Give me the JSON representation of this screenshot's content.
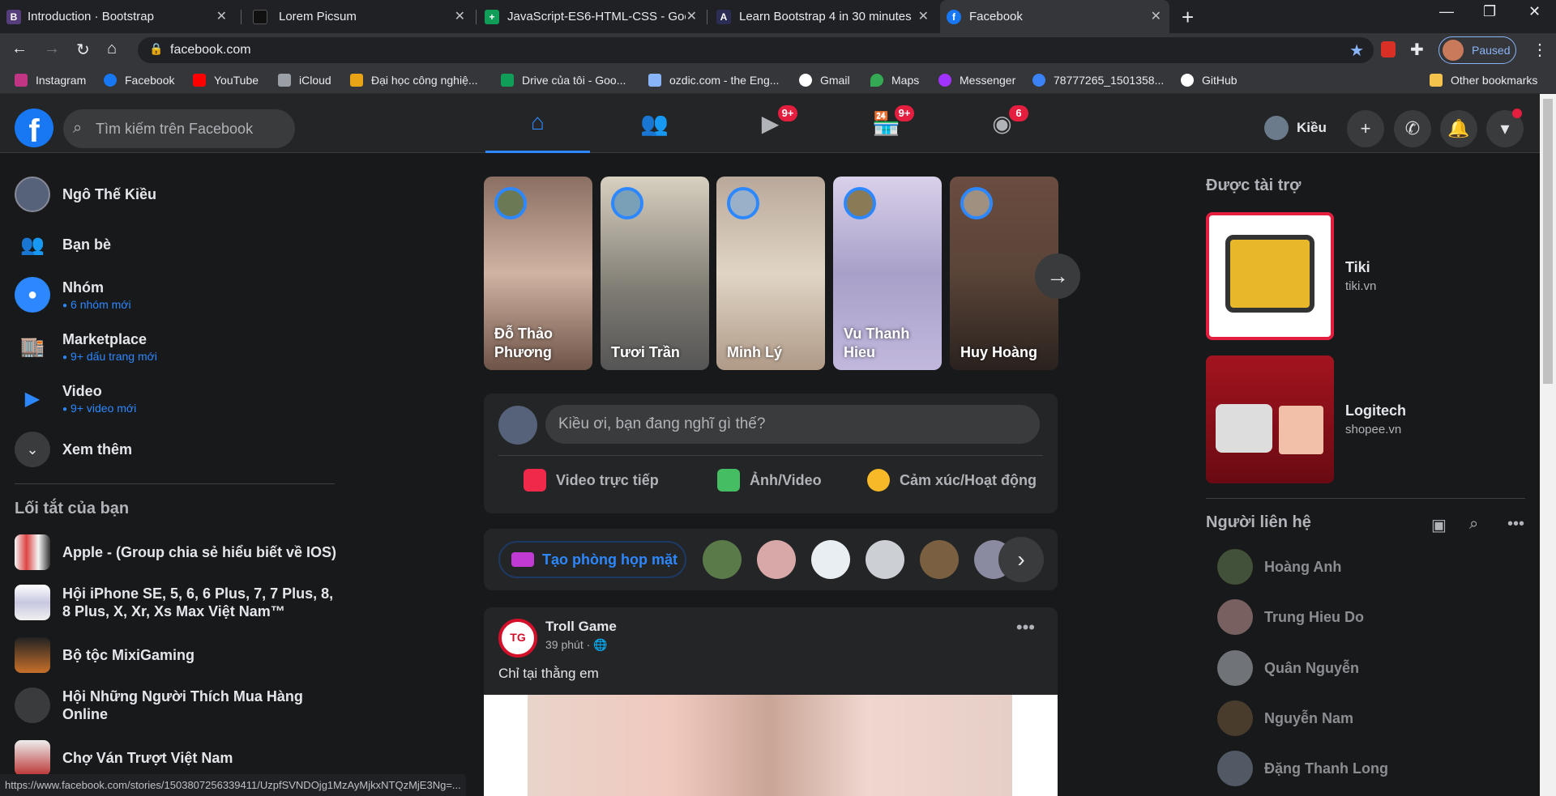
{
  "browser": {
    "tabs": [
      {
        "title": "Introduction · Bootstrap",
        "icon": "bootstrap-icon",
        "color": "#563d7c",
        "glyph": "B"
      },
      {
        "title": "Lorem Picsum",
        "icon": "picsum-icon",
        "color": "#111111",
        "glyph": ""
      },
      {
        "title": "JavaScript-ES6-HTML-CSS - Goo",
        "icon": "sheets-icon",
        "color": "#0f9d58",
        "glyph": "+"
      },
      {
        "title": "Learn Bootstrap 4 in 30 minutes",
        "icon": "scrimba-icon",
        "color": "#2b2d55",
        "glyph": "A"
      },
      {
        "title": "Facebook",
        "icon": "facebook-icon",
        "color": "#1877f2",
        "glyph": "f"
      }
    ],
    "url": "facebook.com",
    "profile_status": "Paused",
    "bookmarks": [
      {
        "label": "Instagram",
        "color": "#c13584"
      },
      {
        "label": "Facebook",
        "color": "#1877f2"
      },
      {
        "label": "YouTube",
        "color": "#ff0000"
      },
      {
        "label": "iCloud",
        "color": "#9aa0a6"
      },
      {
        "label": "Đại học công nghiệ...",
        "color": "#e8a317"
      },
      {
        "label": "Drive của tôi - Goo...",
        "color": "#0f9d58"
      },
      {
        "label": "ozdic.com - the Eng...",
        "color": "#8ab4f8"
      },
      {
        "label": "Gmail",
        "color": "#ffffff"
      },
      {
        "label": "Maps",
        "color": "#34a853"
      },
      {
        "label": "Messenger",
        "color": "#a033ff"
      },
      {
        "label": "78777265_1501358...",
        "color": "#3b82f6"
      },
      {
        "label": "GitHub",
        "color": "#ffffff"
      }
    ],
    "other_bookmarks": "Other bookmarks",
    "status_url": "https://www.facebook.com/stories/1503807256339411/UzpfSVNDOjg1MzAyMjkxNTQzMjE3Ng=..."
  },
  "header": {
    "search_placeholder": "Tìm kiếm trên Facebook",
    "badges": {
      "watch": "9+",
      "marketplace": "9+",
      "groups": "6"
    },
    "profile_name": "Kiều"
  },
  "left": {
    "user_name": "Ngô Thế Kiều",
    "items": [
      {
        "label": "Bạn bè",
        "sub": ""
      },
      {
        "label": "Nhóm",
        "sub": "6 nhóm mới"
      },
      {
        "label": "Marketplace",
        "sub": "9+ dấu trang mới"
      },
      {
        "label": "Video",
        "sub": "9+ video mới"
      }
    ],
    "see_more": "Xem thêm",
    "shortcuts_title": "Lối tắt của bạn",
    "shortcuts": [
      "Apple - (Group chia sẻ hiểu biết về IOS)",
      "Hội iPhone SE, 5, 6, 6 Plus, 7, 7 Plus, 8, 8 Plus, X, Xr, Xs Max Việt Nam™",
      "Bộ tộc MixiGaming",
      "Hội Những Người Thích Mua Hàng Online",
      "Chợ Ván Trượt Việt Nam"
    ]
  },
  "stories": [
    {
      "name": "Đỗ Thảo Phương",
      "color": "#8a6f62"
    },
    {
      "name": "Tươi Trần",
      "color": "#7d7a72"
    },
    {
      "name": "Minh Lý",
      "color": "#b9a89a"
    },
    {
      "name": "Vu Thanh Hieu",
      "color": "#a8a0c8"
    },
    {
      "name": "Huy Hoàng",
      "color": "#5a4438"
    }
  ],
  "composer": {
    "placeholder": "Kiều ơi, bạn đang nghĩ gì thế?",
    "actions": [
      "Video trực tiếp",
      "Ảnh/Video",
      "Cảm xúc/Hoạt động"
    ]
  },
  "rooms": {
    "button": "Tạo phòng họp mặt"
  },
  "post": {
    "author": "Troll Game",
    "time": "39 phút ·",
    "text": "Chỉ tại thằng em",
    "avatar_text": "TG"
  },
  "right": {
    "sponsored_title": "Được tài trợ",
    "ads": [
      {
        "name": "Tiki",
        "url": "tiki.vn"
      },
      {
        "name": "Logitech",
        "url": "shopee.vn"
      }
    ],
    "contacts_title": "Người liên hệ",
    "contacts": [
      "Hoàng Anh",
      "Trung Hieu Do",
      "Quân Nguyễn",
      "Nguyễn Nam",
      "Đặng Thanh Long"
    ]
  }
}
